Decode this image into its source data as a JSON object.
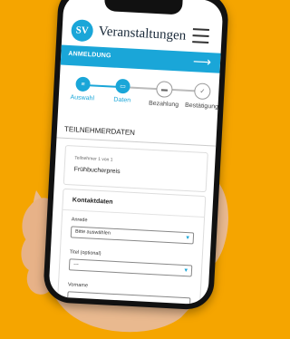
{
  "colors": {
    "background": "#f5a500",
    "accent": "#1aa6d8"
  },
  "header": {
    "logo_text": "SV",
    "brand": "Veranstaltungen"
  },
  "bluebar": {
    "label": "ANMELDUNG",
    "arrow_icon": "arrow-right-icon"
  },
  "steps": [
    {
      "label": "Auswahl",
      "state": "done",
      "icon": "list-icon"
    },
    {
      "label": "Daten",
      "state": "active",
      "icon": "id-card-icon"
    },
    {
      "label": "Bezahlung",
      "state": "pending",
      "icon": "credit-card-icon"
    },
    {
      "label": "Bestätigung",
      "state": "pending",
      "icon": "check-icon"
    }
  ],
  "section": {
    "title": "TEILNEHMERDATEN"
  },
  "participant": {
    "counter": "Teilnehmer 1 von 1",
    "price": "Frühbucherpreis"
  },
  "form": {
    "title": "Kontaktdaten",
    "anrede_label": "Anrede",
    "anrede_value": "Bitte auswählen",
    "titel_label": "Titel (optional)",
    "titel_value": "---",
    "vorname_label": "Vorname"
  }
}
